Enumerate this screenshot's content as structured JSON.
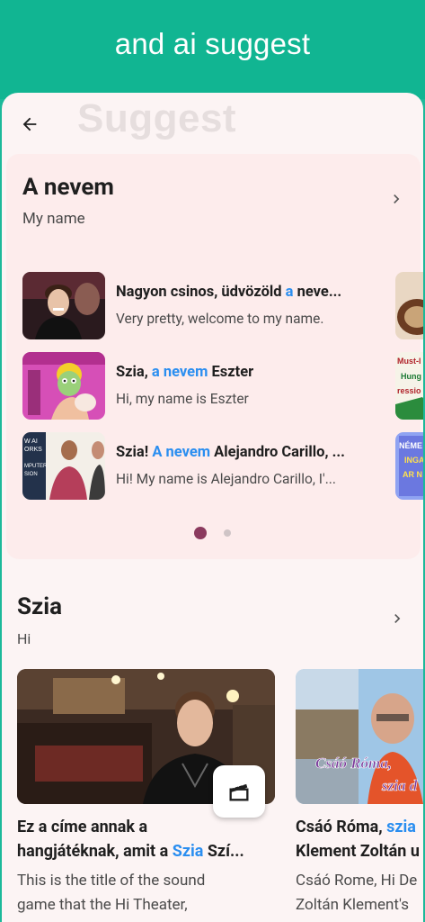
{
  "banner": {
    "title": "and ai suggest"
  },
  "header": {
    "ghost_title": "Suggest"
  },
  "section1": {
    "title": "A nevem",
    "subtitle": "My name",
    "rows": [
      {
        "pre": "Nagyon csinos, üdvözöld ",
        "hl": "a",
        "post": " neve...",
        "translation": "Very pretty, welcome to my name."
      },
      {
        "pre": "Szia, ",
        "hl": "a nevem",
        "post": " Eszter",
        "translation": "Hi, my name is Eszter"
      },
      {
        "pre": "Szia! ",
        "hl": "A nevem",
        "post": " Alejandro Carillo, ...",
        "translation": "Hi! My name is Alejandro Carillo, I'..."
      }
    ],
    "thumb_texts": {
      "row3_lines": [
        "W AI",
        "ORKS",
        "",
        "MPUTER",
        "SION"
      ]
    },
    "peek_texts": {
      "peek2": [
        "Must-l",
        "Hung",
        "ressio"
      ],
      "peek3": [
        "NÉME",
        "INGA",
        "AR N"
      ]
    },
    "pagination": {
      "total": 2,
      "active": 1
    }
  },
  "section2": {
    "title": "Szia",
    "subtitle": "Hi",
    "cards": [
      {
        "title_line1": "Ez a címe annak a",
        "title_line2_pre": "hangjátéknak, amit a ",
        "title_line2_hl": "Szia",
        "title_line2_post": " Szí...",
        "desc_line1": "This is the title of the sound",
        "desc_line2": "game that the Hi Theater,"
      },
      {
        "title_line1_pre": "Csáó Róma, ",
        "title_line1_hl": "szia",
        "title_line2": "Klement Zoltán u",
        "desc_line1": "Csáó Rome, Hi De",
        "desc_line2": "Zoltán Klement's",
        "overlay_line1": "Csáó Róma,",
        "overlay_line2": "szia d"
      }
    ]
  },
  "colors": {
    "banner": "#11b592",
    "sheet": "#fcf4f4",
    "card": "#fdecec",
    "highlight": "#2a8ef0",
    "dot_active": "#8b3a5e",
    "dot_inactive": "#cfc4c6"
  },
  "icons": {
    "back": "arrow-left-icon",
    "chevron": "chevron-right-icon",
    "clip": "clapperboard-icon"
  }
}
